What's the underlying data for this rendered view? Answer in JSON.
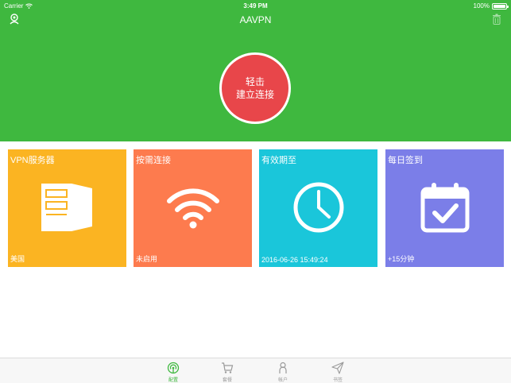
{
  "status_bar": {
    "carrier": "Carrier",
    "time": "3:49 PM",
    "battery": "100%"
  },
  "nav": {
    "title": "AAVPN",
    "left_icon": "user-pin-icon",
    "right_icon": "trash-icon"
  },
  "connect": {
    "line1": "轻击",
    "line2": "建立连接",
    "color": "#e8464a"
  },
  "tiles": [
    {
      "title": "VPN服务器",
      "subtitle": "美国",
      "icon": "server-icon",
      "color": "#fbb422"
    },
    {
      "title": "按需连接",
      "subtitle": "未启用",
      "icon": "wifi-icon",
      "color": "#fd7b4e"
    },
    {
      "title": "有效期至",
      "subtitle": "2016-06-26 15:49:24",
      "icon": "clock-icon",
      "color": "#1ac6da"
    },
    {
      "title": "每日签到",
      "subtitle": "+15分钟",
      "icon": "calendar-check-icon",
      "color": "#7b7ee8"
    }
  ],
  "tab_bar": {
    "items": [
      {
        "label": "配置",
        "icon": "signal-icon",
        "active": true
      },
      {
        "label": "套餐",
        "icon": "cart-icon",
        "active": false
      },
      {
        "label": "帐户",
        "icon": "person-icon",
        "active": false
      },
      {
        "label": "书签",
        "icon": "paper-plane-icon",
        "active": false
      }
    ]
  },
  "colors": {
    "header_green": "#3fb83f",
    "active_tab": "#3fb83f",
    "inactive_tab": "#9a9a9a"
  }
}
